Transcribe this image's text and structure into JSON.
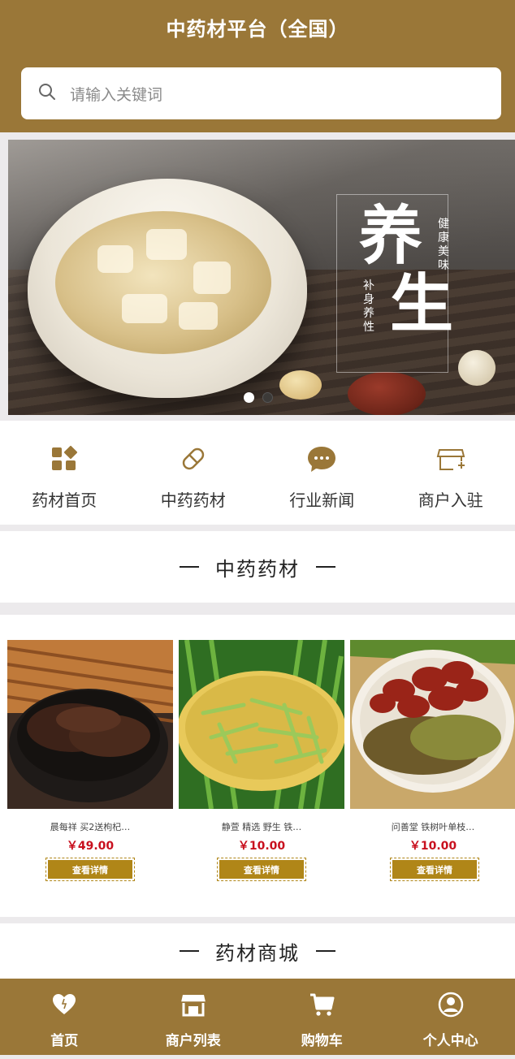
{
  "header": {
    "title": "中药材平台（全国）"
  },
  "search": {
    "placeholder": "请输入关键词"
  },
  "banner": {
    "headline_chars": [
      "养",
      "生"
    ],
    "vertical_texts": [
      "健康 美味",
      "补身 养性"
    ],
    "slide_count": 2,
    "active_slide": 1
  },
  "nav": {
    "items": [
      {
        "label": "药材首页",
        "icon": "grid-apps-icon"
      },
      {
        "label": "中药药材",
        "icon": "capsule-icon"
      },
      {
        "label": "行业新闻",
        "icon": "chat-bubble-icon"
      },
      {
        "label": "商户入驻",
        "icon": "store-add-icon"
      }
    ]
  },
  "sections": {
    "herbs_title": "中药药材",
    "mall_title": "药材商城"
  },
  "products": [
    {
      "name": "晨每祥 买2送枸杞…",
      "price": "￥49.00",
      "button": "查看详情"
    },
    {
      "name": "静萱 精选 野生 铁…",
      "price": "￥10.00",
      "button": "查看详情"
    },
    {
      "name": "问善堂 铁树叶单枝…",
      "price": "￥10.00",
      "button": "查看详情"
    }
  ],
  "tabbar": {
    "items": [
      {
        "label": "首页",
        "icon": "heart-home-icon"
      },
      {
        "label": "商户列表",
        "icon": "store-icon"
      },
      {
        "label": "购物车",
        "icon": "cart-icon"
      },
      {
        "label": "个人中心",
        "icon": "user-icon"
      }
    ]
  },
  "colors": {
    "brand": "#9a7738",
    "button": "#b08618",
    "price": "#c8101e"
  }
}
